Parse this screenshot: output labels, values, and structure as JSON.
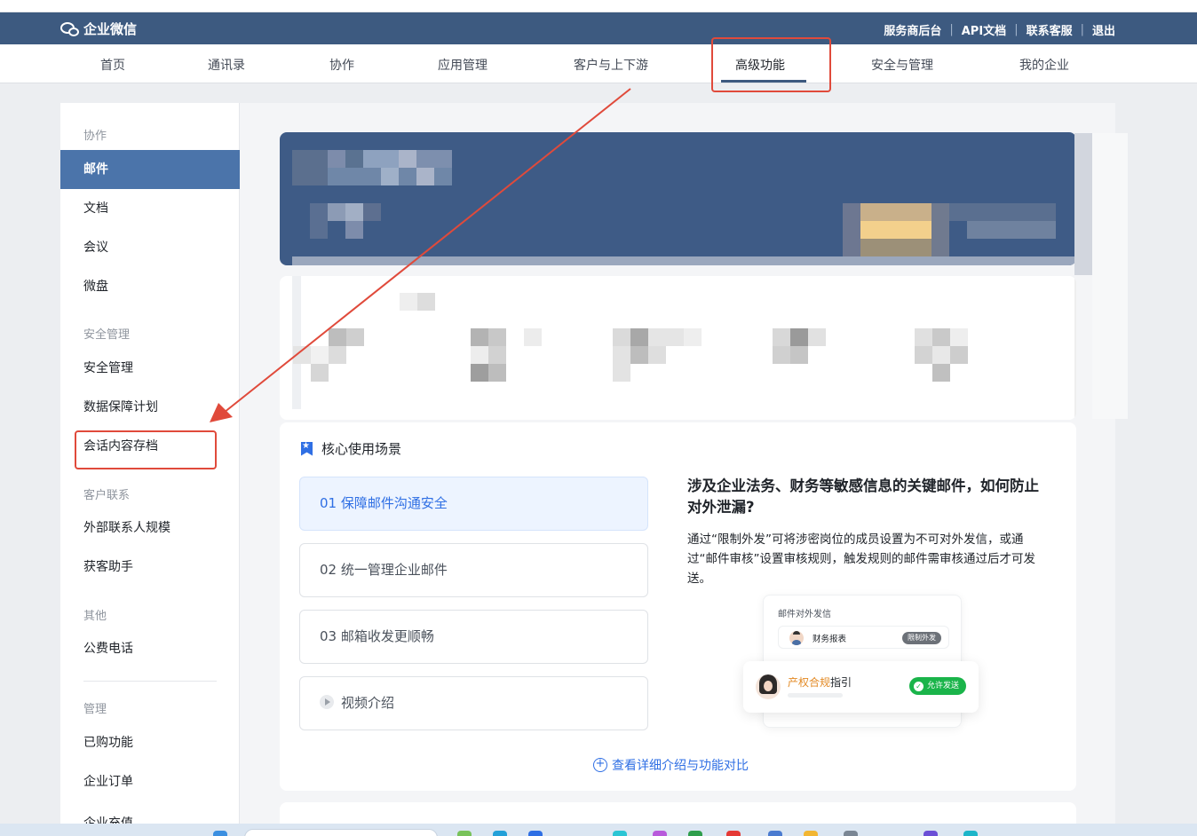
{
  "header": {
    "logo_text": "企业微信",
    "links": [
      "服务商后台",
      "API文档",
      "联系客服",
      "退出"
    ]
  },
  "nav": {
    "items": [
      "首页",
      "通讯录",
      "协作",
      "应用管理",
      "客户与上下游",
      "高级功能",
      "安全与管理",
      "我的企业"
    ],
    "active": "高级功能"
  },
  "sidebar": {
    "groups": {
      "collab": "协作",
      "security": "安全管理",
      "customer": "客户联系",
      "other": "其他",
      "manage": "管理"
    },
    "items": {
      "mail": "邮件",
      "docs": "文档",
      "meeting": "会议",
      "drive": "微盘",
      "security_mgmt": "安全管理",
      "data_plan": "数据保障计划",
      "archive": "会话内容存档",
      "external_contacts": "外部联系人规模",
      "acquisition": "获客助手",
      "public_phone": "公费电话",
      "purchased": "已购功能",
      "orders": "企业订单",
      "recharge": "企业充值"
    },
    "active": "邮件"
  },
  "core": {
    "title": "核心使用场景",
    "scenarios": [
      "01  保障邮件沟通安全",
      "02  统一管理企业邮件",
      "03  邮箱收发更顺畅"
    ],
    "video": "视频介绍",
    "question": "涉及企业法务、财务等敏感信息的关键邮件，如何防止对外泄漏?",
    "description": "通过“限制外发”可将涉密岗位的成员设置为不可对外发信，或通过“邮件审核”设置审核规则，触发规则的邮件需审核通过后才可发送。",
    "mock": {
      "card_title": "邮件对外发信",
      "row_text": "财务报表",
      "restrict_badge": "限制外发",
      "guide_highlight": "产权合规",
      "guide_rest": "指引",
      "allow_badge": "允许发送"
    },
    "more_link": "查看详细介绍与功能对比"
  },
  "colors": {
    "header_bg": "#3d5a80",
    "sidebar_active": "#4b74aa",
    "accent_blue": "#2f6fe4",
    "annotation_red": "#e04a3b",
    "allow_green": "#1ab44a"
  }
}
